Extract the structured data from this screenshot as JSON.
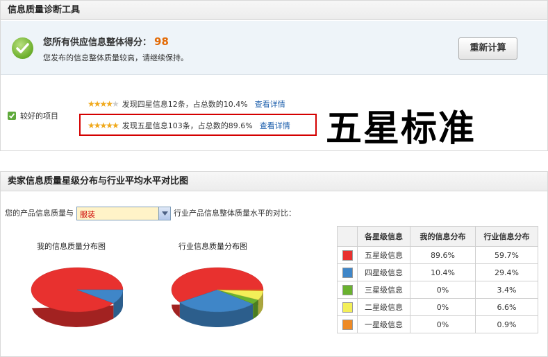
{
  "top_panel": {
    "title": "信息质量诊断工具",
    "score_label": "您所有供应信息整体得分：",
    "score_value": "98",
    "score_sub": "您发布的信息整体质量较高，请继续保持。",
    "recalc_button": "重新计算"
  },
  "good_items": {
    "label": "较好的项目",
    "rows": [
      {
        "stars_filled": 4,
        "stars_total": 5,
        "text": "发现四星信息12条，占总数的10.4%",
        "link": "查看详情"
      },
      {
        "stars_filled": 5,
        "stars_total": 5,
        "text": "发现五星信息103条，占总数的89.6%",
        "link": "查看详情"
      }
    ]
  },
  "annotation_big": "五星标准",
  "bottom_panel": {
    "title": "卖家信息质量星级分布与行业平均水平对比图",
    "compare_prefix": "您的产品信息质量与",
    "industry_select": "服装",
    "compare_suffix": "行业产品信息整体质量水平的对比：",
    "pie_mine_title": "我的信息质量分布图",
    "pie_industry_title": "行业信息质量分布图"
  },
  "table": {
    "headers": [
      "",
      "各星级信息",
      "我的信息分布",
      "行业信息分布"
    ],
    "rows": [
      {
        "color": "#e8312f",
        "level": "五星级信息",
        "mine": "89.6%",
        "industry": "59.7%"
      },
      {
        "color": "#3f86c8",
        "level": "四星级信息",
        "mine": "10.4%",
        "industry": "29.4%"
      },
      {
        "color": "#6ab22f",
        "level": "三星级信息",
        "mine": "0%",
        "industry": "3.4%"
      },
      {
        "color": "#f3ef58",
        "level": "二星级信息",
        "mine": "0%",
        "industry": "6.6%"
      },
      {
        "color": "#ee8a25",
        "level": "一星级信息",
        "mine": "0%",
        "industry": "0.9%"
      }
    ]
  },
  "chart_data": [
    {
      "type": "pie",
      "title": "我的信息质量分布图",
      "categories": [
        "五星级信息",
        "四星级信息",
        "三星级信息",
        "二星级信息",
        "一星级信息"
      ],
      "values": [
        89.6,
        10.4,
        0,
        0,
        0
      ],
      "colors": [
        "#e8312f",
        "#3f86c8",
        "#6ab22f",
        "#f3ef58",
        "#ee8a25"
      ]
    },
    {
      "type": "pie",
      "title": "行业信息质量分布图",
      "categories": [
        "五星级信息",
        "四星级信息",
        "三星级信息",
        "二星级信息",
        "一星级信息"
      ],
      "values": [
        59.7,
        29.4,
        3.4,
        6.6,
        0.9
      ],
      "colors": [
        "#e8312f",
        "#3f86c8",
        "#6ab22f",
        "#f3ef58",
        "#ee8a25"
      ]
    }
  ]
}
